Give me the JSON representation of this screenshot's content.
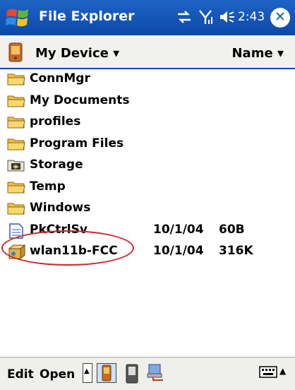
{
  "window": {
    "title": "File Explorer",
    "clock": "2:43"
  },
  "statusbar": {
    "icons": [
      "start-flag-icon",
      "connectivity-icon",
      "signal-icon",
      "volume-icon",
      "close-icon"
    ],
    "close_label": "✕"
  },
  "location": {
    "label": "My Device",
    "dropdown_glyph": "▾",
    "sort_label": "Name",
    "sort_glyph": "▾"
  },
  "files": [
    {
      "name": "ConnMgr",
      "type": "folder",
      "date": "",
      "size": ""
    },
    {
      "name": "My Documents",
      "type": "folder",
      "date": "",
      "size": ""
    },
    {
      "name": "profiles",
      "type": "folder",
      "date": "",
      "size": ""
    },
    {
      "name": "Program Files",
      "type": "folder",
      "date": "",
      "size": ""
    },
    {
      "name": "Storage",
      "type": "storage-folder",
      "date": "",
      "size": ""
    },
    {
      "name": "Temp",
      "type": "folder",
      "date": "",
      "size": ""
    },
    {
      "name": "Windows",
      "type": "folder",
      "date": "",
      "size": ""
    },
    {
      "name": "PkCtrlSv",
      "type": "document",
      "date": "10/1/04",
      "size": "60B"
    },
    {
      "name": "wlan11b-FCC",
      "type": "cab-installer",
      "date": "10/1/04",
      "size": "316K"
    }
  ],
  "menubar": {
    "edit_label": "Edit",
    "open_label": "Open",
    "up_glyph": "▲"
  },
  "colors": {
    "titlebar": "#0b49a8",
    "folder": "#f0c040",
    "highlight": "#c8252a"
  }
}
